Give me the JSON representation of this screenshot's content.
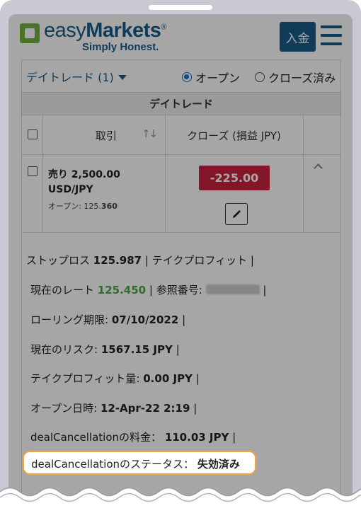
{
  "header": {
    "logo_word1": "easy",
    "logo_word2": "Markets",
    "logo_reg": "®",
    "tagline": "Simply Honest.",
    "deposit_label": "入金"
  },
  "filter": {
    "dropdown_label": "デイトレード (1)",
    "radio_open": "オープン",
    "radio_closed": "クローズ済み",
    "selected": "オープン"
  },
  "table": {
    "section_title": "デイトレード",
    "col_trade": "取引",
    "col_close": "クローズ (損益 JPY)",
    "row": {
      "side": "売り 2,500.00",
      "symbol": "USD/JPY",
      "open_label": "オープン: 125.",
      "open_bold": "360",
      "pl": "-225.00"
    }
  },
  "details": {
    "stoploss_label": "ストップロス",
    "stoploss_value": "125.987",
    "takeprofit_label": "| テイクプロフィット |",
    "rate_label": "現在のレート",
    "rate_value": "125.450",
    "ref_label": "| 参照番号:",
    "rolling_label": "ローリング期限:",
    "rolling_value": "07/10/2022",
    "risk_label": "現在のリスク:",
    "risk_value": "1567.15 JPY",
    "tp_amount_label": "テイクプロフィット量:",
    "tp_amount_value": "0.00 JPY",
    "open_date_label": "オープン日時:",
    "open_date_value": "12-Apr-22 2:19",
    "dc_fee_label": "dealCancellationの料金：",
    "dc_fee_value": "110.03 JPY",
    "dc_status_label": "dealCancellationのステータス：",
    "dc_status_value": "失効済み",
    "sep": "|"
  },
  "colors": {
    "brand_blue": "#1a5d8a",
    "brand_green": "#6eb33f",
    "loss_red": "#c9243f",
    "highlight_orange": "#f2a33a"
  }
}
